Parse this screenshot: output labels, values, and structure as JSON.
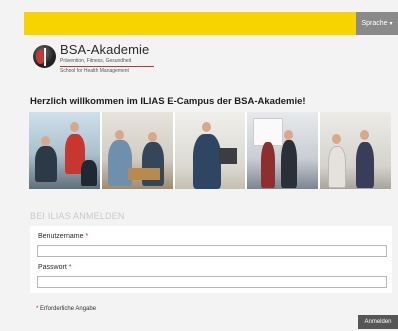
{
  "topbar": {
    "language_label": "Sprache"
  },
  "logo": {
    "brand": "BSA-Akademie",
    "tagline": "Prävention, Fitness, Gesundheit",
    "subtag": "School for Health Management"
  },
  "welcome": "Herzlich willkommen im ILIAS E-Campus der BSA-Akademie!",
  "login": {
    "title": "BEI ILIAS ANMELDEN",
    "username_label": "Benutzername",
    "password_label": "Passwort",
    "required_marker": "*",
    "required_note": "Erforderliche Angabe",
    "submit_label": "Anmelden"
  },
  "colors": {
    "topbar": "#f7d300",
    "required": "#c81e1e",
    "submit": "#565656"
  }
}
